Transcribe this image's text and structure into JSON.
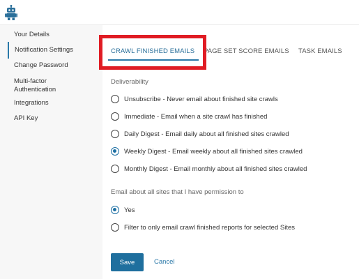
{
  "app": {
    "logo_icon": "robot-logo-icon"
  },
  "sidebar": {
    "items": [
      {
        "label": "Your Details"
      },
      {
        "label": "Notification Settings"
      },
      {
        "label": "Change Password"
      },
      {
        "label": "Multi-factor\nAuthentication"
      },
      {
        "label": "Integrations"
      },
      {
        "label": "API Key"
      }
    ],
    "active_item": "Notification Settings"
  },
  "tabs": {
    "items": [
      {
        "label": "CRAWL FINISHED EMAILS"
      },
      {
        "label": "PAGE SET SCORE EMAILS"
      },
      {
        "label": "TASK EMAILS"
      }
    ],
    "active_tab": "CRAWL FINISHED EMAILS"
  },
  "deliverability": {
    "label": "Deliverability",
    "options": [
      {
        "label": "Unsubscribe - Never email about finished site crawls",
        "checked": false
      },
      {
        "label": "Immediate - Email when a site crawl has finished",
        "checked": false
      },
      {
        "label": "Daily Digest - Email daily about all finished sites crawled",
        "checked": false
      },
      {
        "label": "Weekly Digest - Email weekly about all finished sites crawled",
        "checked": true
      },
      {
        "label": "Monthly Digest - Email monthly about all finished sites crawled",
        "checked": false
      }
    ]
  },
  "site_permission": {
    "label": "Email about all sites that I have permission to",
    "options": [
      {
        "label": "Yes",
        "checked": true
      },
      {
        "label": "Filter to only email crawl finished reports for selected Sites",
        "checked": false
      }
    ]
  },
  "actions": {
    "save_label": "Save",
    "cancel_label": "Cancel"
  },
  "colors": {
    "accent": "#1f6f9e",
    "highlight": "#e01c24"
  }
}
